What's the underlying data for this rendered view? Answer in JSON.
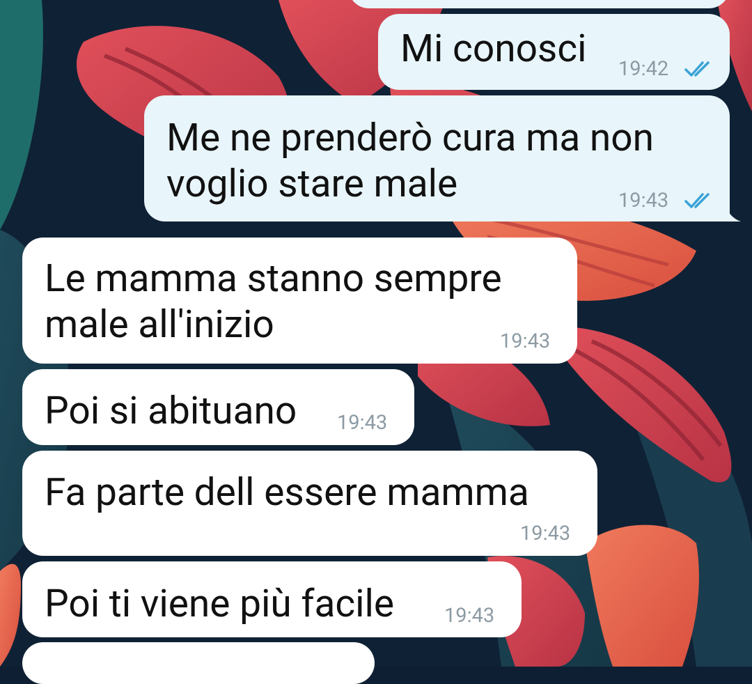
{
  "colors": {
    "incoming_bubble": "#ffffff",
    "outgoing_bubble": "#e8f5fa",
    "timestamp": "#8c9aa3",
    "read_ticks": "#3aa3d6",
    "message_text": "#111111"
  },
  "messages": [
    {
      "direction": "out",
      "text": "Mi conosci",
      "time": "19:42",
      "status": "read-double-check-icon"
    },
    {
      "direction": "out",
      "text": "Me ne prenderò cura ma non\nvoglio stare male",
      "time": "19:43",
      "status": "read-double-check-icon"
    },
    {
      "direction": "in",
      "text": "Le mamma stanno sempre\nmale all'inizio",
      "time": "19:43"
    },
    {
      "direction": "in",
      "text": "Poi si abituano",
      "time": "19:43"
    },
    {
      "direction": "in",
      "text": "Fa parte dell essere mamma",
      "time": "19:43"
    },
    {
      "direction": "in",
      "text": "Poi ti viene più facile",
      "time": "19:43"
    }
  ]
}
